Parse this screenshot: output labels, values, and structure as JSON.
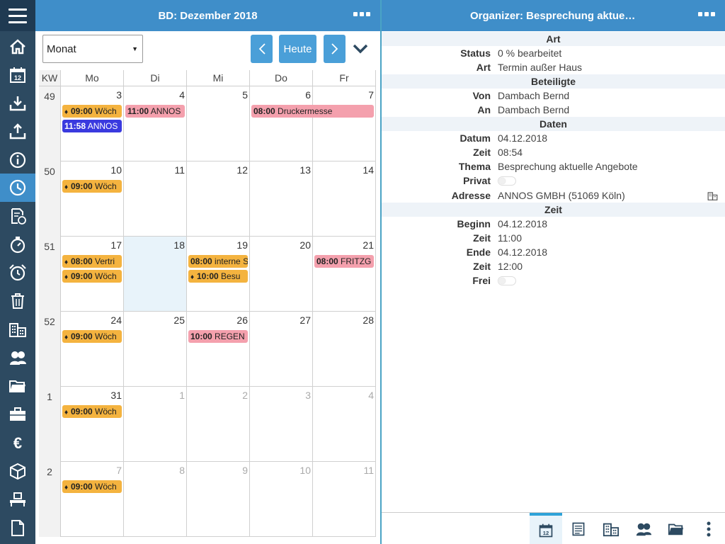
{
  "sidebar": {
    "icons": [
      "menu-icon",
      "home-icon",
      "calendar-icon",
      "download-icon",
      "upload-icon",
      "info-icon",
      "clock-icon",
      "document-clock-icon",
      "stopwatch-icon",
      "alarm-icon",
      "trash-icon",
      "buildings-icon",
      "contacts-icon",
      "folder-icon",
      "briefcase-icon",
      "euro-icon",
      "box-icon",
      "conveyor-icon",
      "page-icon"
    ],
    "active": "clock-icon"
  },
  "calendar": {
    "title": "BD: Dezember 2018",
    "view_select": "Monat",
    "today_label": "Heute",
    "columns": [
      "KW",
      "Mo",
      "Di",
      "Mi",
      "Do",
      "Fr"
    ],
    "weeks": [
      {
        "kw": "49",
        "days": [
          {
            "num": "3",
            "events": [
              {
                "time": "09:00",
                "text": "Wöch",
                "color": "orange",
                "repeat": true
              },
              {
                "time": "11:58",
                "text": "ANNOS",
                "color": "blue"
              }
            ]
          },
          {
            "num": "4",
            "events": [
              {
                "time": "11:00",
                "text": "ANNOS",
                "color": "pink"
              }
            ]
          },
          {
            "num": "5",
            "events": []
          },
          {
            "num": "6",
            "events": []
          },
          {
            "num": "7",
            "events": []
          }
        ]
      },
      {
        "kw": "50",
        "days": [
          {
            "num": "10",
            "events": [
              {
                "time": "09:00",
                "text": "Wöch",
                "color": "orange",
                "repeat": true
              }
            ]
          },
          {
            "num": "11",
            "events": []
          },
          {
            "num": "12",
            "events": []
          },
          {
            "num": "13",
            "events": []
          },
          {
            "num": "14",
            "events": []
          }
        ]
      },
      {
        "kw": "51",
        "days": [
          {
            "num": "17",
            "events": [
              {
                "time": "08:00",
                "text": "Vertri",
                "color": "orange",
                "repeat": true
              },
              {
                "time": "09:00",
                "text": "Wöch",
                "color": "orange",
                "repeat": true
              }
            ]
          },
          {
            "num": "18",
            "today": true,
            "events": []
          },
          {
            "num": "19",
            "events": [
              {
                "time": "08:00",
                "text": "interne S",
                "color": "orange"
              },
              {
                "time": "10:00",
                "text": "Besu",
                "color": "orange",
                "repeat": true
              }
            ]
          },
          {
            "num": "20",
            "events": []
          },
          {
            "num": "21",
            "events": [
              {
                "time": "08:00",
                "text": "FRITZG",
                "color": "pink"
              }
            ]
          }
        ]
      },
      {
        "kw": "52",
        "days": [
          {
            "num": "24",
            "events": [
              {
                "time": "09:00",
                "text": "Wöch",
                "color": "orange",
                "repeat": true
              }
            ]
          },
          {
            "num": "25",
            "events": []
          },
          {
            "num": "26",
            "events": [
              {
                "time": "10:00",
                "text": "REGEN",
                "color": "pink"
              }
            ]
          },
          {
            "num": "27",
            "events": []
          },
          {
            "num": "28",
            "events": []
          }
        ]
      },
      {
        "kw": "1",
        "days": [
          {
            "num": "31",
            "events": [
              {
                "time": "09:00",
                "text": "Wöch",
                "color": "orange",
                "repeat": true
              }
            ]
          },
          {
            "num": "1",
            "other": true,
            "events": []
          },
          {
            "num": "2",
            "other": true,
            "events": []
          },
          {
            "num": "3",
            "other": true,
            "events": []
          },
          {
            "num": "4",
            "other": true,
            "events": []
          }
        ]
      },
      {
        "kw": "2",
        "days": [
          {
            "num": "7",
            "other": true,
            "events": [
              {
                "time": "09:00",
                "text": "Wöch",
                "color": "orange",
                "repeat": true
              }
            ]
          },
          {
            "num": "8",
            "other": true,
            "events": []
          },
          {
            "num": "9",
            "other": true,
            "events": []
          },
          {
            "num": "10",
            "other": true,
            "events": []
          },
          {
            "num": "11",
            "other": true,
            "events": []
          }
        ]
      }
    ],
    "spanning_event": {
      "time": "08:00",
      "text": "Druckermesse",
      "color": "pink",
      "from": "Do",
      "to": "Fr",
      "week": "49"
    },
    "colors": {
      "header": "#3f8ec9",
      "orange": "#f4b33f",
      "pink": "#f4a0ad",
      "blue": "#3a3adf",
      "today": "#e8f3fa"
    }
  },
  "organizer": {
    "title": "Organizer: Besprechung aktue…",
    "sections": {
      "art": "Art",
      "beteiligte": "Beteiligte",
      "daten": "Daten",
      "zeit": "Zeit"
    },
    "fields": {
      "status": {
        "label": "Status",
        "value": "0 % bearbeitet"
      },
      "art": {
        "label": "Art",
        "value": "Termin außer Haus"
      },
      "von": {
        "label": "Von",
        "value": "Dambach Bernd"
      },
      "an": {
        "label": "An",
        "value": "Dambach Bernd"
      },
      "datum": {
        "label": "Datum",
        "value": "04.12.2018"
      },
      "zeit": {
        "label": "Zeit",
        "value": "08:54"
      },
      "thema": {
        "label": "Thema",
        "value": "Besprechung aktuelle Angebote"
      },
      "privat": {
        "label": "Privat",
        "value": false
      },
      "adresse": {
        "label": "Adresse",
        "value": "ANNOS GMBH (51069 Köln)"
      },
      "beginn": {
        "label": "Beginn",
        "value": "04.12.2018"
      },
      "beginn_zeit": {
        "label": "Zeit",
        "value": "11:00"
      },
      "ende": {
        "label": "Ende",
        "value": "04.12.2018"
      },
      "ende_zeit": {
        "label": "Zeit",
        "value": "12:00"
      },
      "frei": {
        "label": "Frei",
        "value": false
      }
    },
    "bottom_tabs": [
      "calendar-icon",
      "list-icon",
      "buildings-icon",
      "contacts-icon",
      "folder-icon",
      "more-icon"
    ],
    "active_tab": "calendar-icon"
  }
}
